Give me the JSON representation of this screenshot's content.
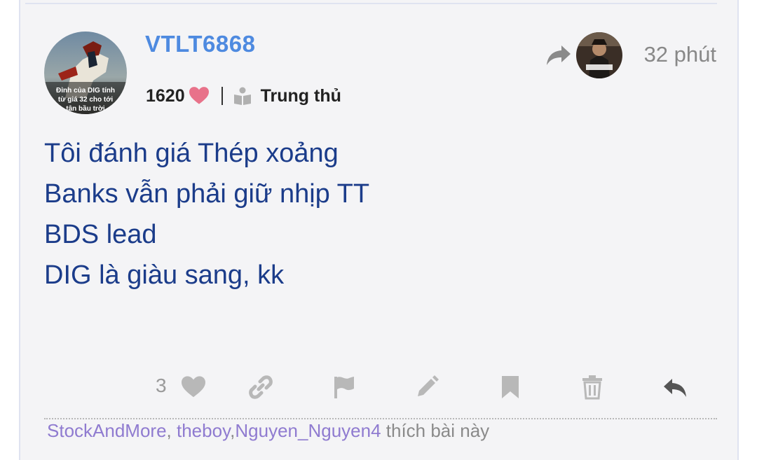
{
  "post": {
    "username": "VTLT6868",
    "score": "1620",
    "rank": "Trung thủ",
    "time": "32 phút",
    "avatar_caption_lines": [
      "Đỉnh của DIG tính",
      "từ giá 32 cho tới",
      "tận bầu trời"
    ],
    "content_lines": [
      "Tôi đánh giá Thép xoảng",
      "Banks vẫn phải giữ nhịp TT",
      "BDS lead",
      "DIG là giàu sang, kk"
    ]
  },
  "actions": {
    "like_count": "3",
    "icons": [
      "heart-icon",
      "link-icon",
      "flag-icon",
      "pencil-icon",
      "bookmark-icon",
      "trash-icon",
      "reply-icon"
    ]
  },
  "likes": {
    "users": [
      "StockAndMore",
      "theboy",
      "Nguyen_Nguyen4"
    ],
    "separator1": ", ",
    "separator2": ",",
    "suffix": " thích bài này"
  },
  "colors": {
    "username": "#4e8ae0",
    "content": "#1b3c8a",
    "heart": "#e8728a",
    "liker": "#8f7bd0",
    "background": "#f4f4f6"
  }
}
